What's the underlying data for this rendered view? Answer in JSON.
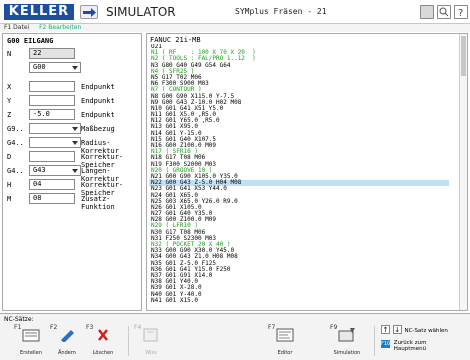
{
  "header": {
    "logo_text": "KELLER",
    "mode_label": "SIMULATOR",
    "document_title": "SYMplus Fräsen - 21"
  },
  "menustrip": {
    "items": [
      "F1 Datei",
      "F2 Bearbeiten"
    ]
  },
  "left_panel": {
    "title": "G00 EILGANG",
    "rows": [
      {
        "label": "N",
        "value": "22",
        "desc": ""
      },
      {
        "label": "",
        "value": "G00",
        "desc": ""
      },
      {
        "label": "X",
        "value": "",
        "desc": "Endpunkt"
      },
      {
        "label": "Y",
        "value": "",
        "desc": "Endpunkt"
      },
      {
        "label": "Z",
        "value": "-5.0",
        "desc": "Endpunkt"
      },
      {
        "label": "G9..",
        "value": "",
        "desc": "Maßbezug"
      },
      {
        "label": "G4..",
        "value": "",
        "desc": "Radius-Korrektur"
      },
      {
        "label": "D",
        "value": "",
        "desc": "Korrektur-Speicher"
      },
      {
        "label": "G4..",
        "value": "G43",
        "desc": "Längen-Korrektur"
      },
      {
        "label": "H",
        "value": "04",
        "desc": "Korrektur-Speicher"
      },
      {
        "label": "M",
        "value": "08",
        "desc": "Zusatz-Funktion"
      }
    ]
  },
  "right_panel": {
    "title": "FANUC 21i-MB",
    "lines": [
      {
        "text": "O21",
        "type": "normal"
      },
      {
        "text": "N1 ( RF    : 100 X 70 X 20  )",
        "type": "comment"
      },
      {
        "text": "N2 ( TOOLS : FAL/PRO 1..12  )",
        "type": "comment"
      },
      {
        "text": "N3 G80 G40 G49 G54 G64",
        "type": "normal"
      },
      {
        "text": "N4 ( SFR25 )",
        "type": "comment"
      },
      {
        "text": "N5 G17 T02 M06",
        "type": "normal"
      },
      {
        "text": "N6 F300 S900 M03",
        "type": "normal"
      },
      {
        "text": "N7 ( CONTOUR )",
        "type": "comment"
      },
      {
        "text": "N8 G00 G90 X115.0 Y-7.5",
        "type": "normal"
      },
      {
        "text": "N9 G00 G43 Z-10.0 H02 M08",
        "type": "normal"
      },
      {
        "text": "N10 G01 G41 X51 Y5.0",
        "type": "normal"
      },
      {
        "text": "N11 G01 X5.0 ,R5.0",
        "type": "normal"
      },
      {
        "text": "N12 G01 Y65.0 ,R5.0",
        "type": "normal"
      },
      {
        "text": "N13 G01 X95.0",
        "type": "normal"
      },
      {
        "text": "N14 G01 Y-15.0",
        "type": "normal"
      },
      {
        "text": "N15 G01 G40 X107.5",
        "type": "normal"
      },
      {
        "text": "N16 G00 Z100.0 M09",
        "type": "normal"
      },
      {
        "text": "N17 ( SFR16 )",
        "type": "comment"
      },
      {
        "text": "N18 G17 T08 M06",
        "type": "normal"
      },
      {
        "text": "N19 F300 S2000 M03",
        "type": "normal"
      },
      {
        "text": "N20 ( GROOVE 10 )",
        "type": "comment"
      },
      {
        "text": "N21 G00 G90 X105.0 Y35.0",
        "type": "normal"
      },
      {
        "text": "N22 G00 G43 Z-5.0 H04 M08",
        "type": "selected"
      },
      {
        "text": "N23 G01 G41 X53 Y44.0",
        "type": "normal"
      },
      {
        "text": "N24 G01 X65.0",
        "type": "normal"
      },
      {
        "text": "N25 G03 X65.0 Y26.0 R9.0",
        "type": "normal"
      },
      {
        "text": "N26 G01 X105.0",
        "type": "normal"
      },
      {
        "text": "N27 G01 G40 Y35.0",
        "type": "normal"
      },
      {
        "text": "N28 G00 Z100.0 M09",
        "type": "normal"
      },
      {
        "text": "N29 ( LFR10 )",
        "type": "comment"
      },
      {
        "text": "N30 G17 T08 M06",
        "type": "normal"
      },
      {
        "text": "N31 F250 S2300 M03",
        "type": "normal"
      },
      {
        "text": "N32 ( POCKET 20 X 40 )",
        "type": "comment"
      },
      {
        "text": "N33 G00 G90 X30.0 Y45.0",
        "type": "normal"
      },
      {
        "text": "N34 G00 G43 Z1.0 H08 M08",
        "type": "normal"
      },
      {
        "text": "N35 G01 Z-5.0 F125",
        "type": "normal"
      },
      {
        "text": "N36 G01 G41 Y15.0 F250",
        "type": "normal"
      },
      {
        "text": "N37 G01 G91 X14.0",
        "type": "normal"
      },
      {
        "text": "N38 G01 Y40.0",
        "type": "normal"
      },
      {
        "text": "N39 G01 X-28.0",
        "type": "normal"
      },
      {
        "text": "N40 G01 Y-40.0",
        "type": "normal"
      },
      {
        "text": "N41 G01 X15.0",
        "type": "normal"
      }
    ]
  },
  "bottom": {
    "title": "NC-Sätze:",
    "fkeys": [
      {
        "key": "F1",
        "caption": "Erstellen"
      },
      {
        "key": "F2",
        "caption": "Ändern"
      },
      {
        "key": "F3",
        "caption": "Löschen"
      },
      {
        "key": "F4",
        "caption": "Wiss"
      },
      {
        "key": "F7",
        "caption": "Editor"
      },
      {
        "key": "F9",
        "caption": "Simulation"
      }
    ],
    "next_label": "NC-Satz wählen",
    "f10_key": "F10",
    "f10_line1": "Zurück zum",
    "f10_line2": "Hauptmenü"
  },
  "colors": {
    "brand": "#1d4f9c",
    "comment": "#1aa31a",
    "selection": "#bfe0f5"
  }
}
